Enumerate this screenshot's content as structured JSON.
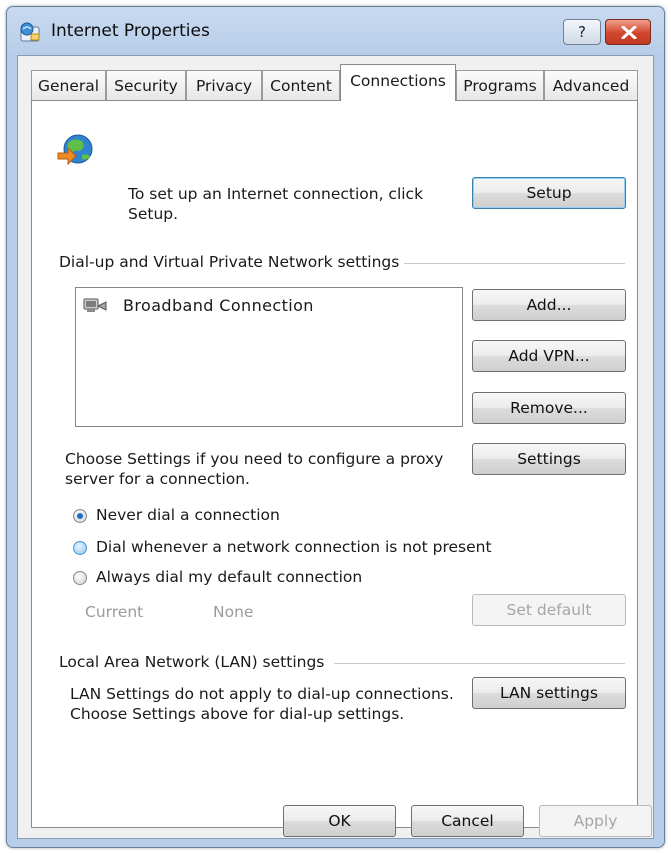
{
  "window": {
    "title": "Internet Properties",
    "help_label": "?"
  },
  "tabs": [
    {
      "label": "General"
    },
    {
      "label": "Security"
    },
    {
      "label": "Privacy"
    },
    {
      "label": "Content"
    },
    {
      "label": "Connections",
      "active": true
    },
    {
      "label": "Programs"
    },
    {
      "label": "Advanced"
    }
  ],
  "setup": {
    "text_line1": "To set up an Internet connection, click",
    "text_line2": "Setup.",
    "button": "Setup"
  },
  "dialup": {
    "group_label": "Dial-up and Virtual Private Network settings",
    "connections": [
      "Broadband Connection"
    ],
    "add_button": "Add...",
    "add_vpn_button": "Add VPN...",
    "remove_button": "Remove...",
    "settings_text_line1": "Choose Settings if you need to configure a proxy",
    "settings_text_line2": "server for a connection.",
    "settings_button": "Settings",
    "radio_options": [
      {
        "label": "Never dial a connection",
        "checked": true
      },
      {
        "label": "Dial whenever a network connection is not present",
        "checked": false
      },
      {
        "label": "Always dial my default connection",
        "checked": false
      }
    ],
    "current_label": "Current",
    "current_value": "None",
    "set_default_button": "Set default"
  },
  "lan": {
    "group_label": "Local Area Network (LAN) settings",
    "text_line1": "LAN Settings do not apply to dial-up connections.",
    "text_line2": "Choose Settings above for dial-up settings.",
    "button": "LAN settings"
  },
  "footer": {
    "ok": "OK",
    "cancel": "Cancel",
    "apply": "Apply"
  },
  "colors": {
    "title_bar": "#b7cde8",
    "close_button": "#d2452d",
    "radio_checked": "#1f6fc0"
  }
}
